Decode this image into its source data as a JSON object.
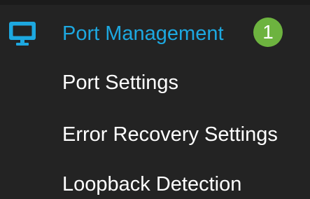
{
  "nav": {
    "header": {
      "label": "Port Management",
      "icon": "monitor-icon",
      "step_badge": "1",
      "label_color": "#1da8e0",
      "badge_color": "#6db33f"
    },
    "items": [
      {
        "label": "Port Settings"
      },
      {
        "label": "Error Recovery Settings"
      },
      {
        "label": "Loopback Detection"
      }
    ]
  }
}
